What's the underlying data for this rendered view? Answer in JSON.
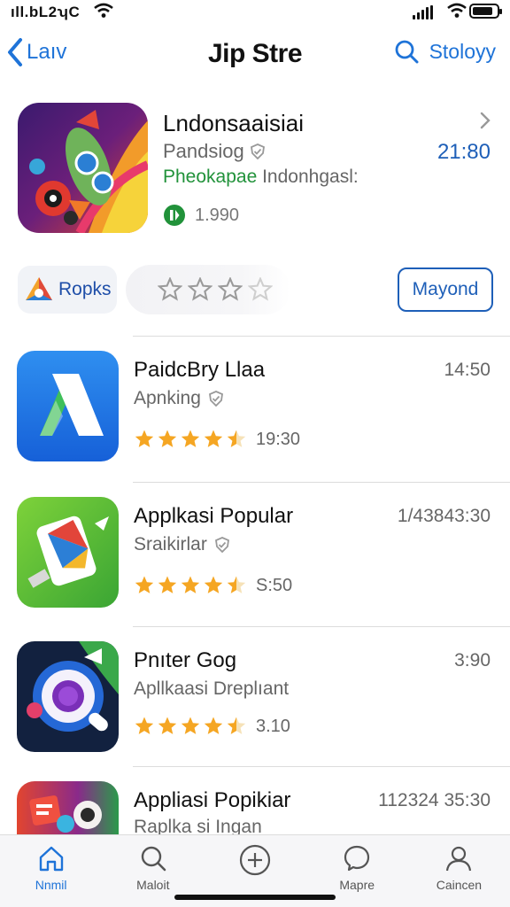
{
  "status_bar": {
    "carrier": "ıll.bL2ʮC",
    "battery_level": 0.85
  },
  "nav": {
    "back_label": "Laıv",
    "title": "Jip Stre",
    "search_label": "Stoloyy"
  },
  "featured": {
    "title": "Lndonsaaisiai",
    "subtitle": "Pandsiog",
    "price": "21:80",
    "tagline_green": "Pheokapae",
    "tagline_rest": " Indonhgasl:",
    "rating_count": "1.990"
  },
  "filters": {
    "chip_label": "Ropks",
    "rating_stars": 4,
    "manage_label": "Mayond"
  },
  "apps": [
    {
      "name": "PaidcBry Llaa",
      "subtitle": "Apnking",
      "time": "14:50",
      "rating": "19:30",
      "stars": 4.5
    },
    {
      "name": "Applkasi Popular",
      "subtitle": "Sraikirlar",
      "time": "1/43843:30",
      "rating": "S:50",
      "stars": 4.5
    },
    {
      "name": "Pnıter Gog",
      "subtitle": "Apllkaasi Dreplıant",
      "time": "3:90",
      "rating": "3.10",
      "stars": 4.5
    },
    {
      "name": "Appliasi Popikiar",
      "subtitle": "Raplka si Ingan",
      "time": "112324 35:30",
      "rating": "",
      "stars": 0
    }
  ],
  "tabs": [
    {
      "label": "Nnmil",
      "icon": "home-icon",
      "active": true
    },
    {
      "label": "Maloit",
      "icon": "search-icon",
      "active": false
    },
    {
      "label": "",
      "icon": "plus-icon",
      "active": false
    },
    {
      "label": "Mapre",
      "icon": "chat-icon",
      "active": false
    },
    {
      "label": "Caincen",
      "icon": "person-icon",
      "active": false
    }
  ],
  "colors": {
    "accent": "#1e73d8",
    "star": "#f5a623",
    "green": "#21923a"
  }
}
